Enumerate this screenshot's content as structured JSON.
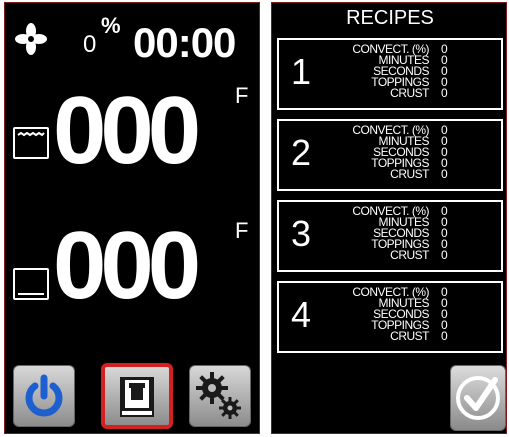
{
  "status": {
    "fan_icon": "fan-icon",
    "convection_percent": "0",
    "percent_sign": "%",
    "timer": "00:00"
  },
  "top_oven": {
    "icon": "top-oven-icon",
    "temperature": "000",
    "unit": "F"
  },
  "bottom_oven": {
    "icon": "bottom-oven-icon",
    "temperature": "000",
    "unit": "F"
  },
  "bottom_buttons": {
    "power": "power-icon",
    "recipes": "recipe-book-icon",
    "settings": "gears-icon",
    "selected_border_color": "#d42020"
  },
  "recipes": {
    "title": "RECIPES",
    "labels": [
      "CONVECT. (%)",
      "MINUTES",
      "SECONDS",
      "TOPPINGS",
      "CRUST"
    ],
    "items": [
      {
        "number": "1",
        "values": [
          "0",
          "0",
          "0",
          "0",
          "0"
        ]
      },
      {
        "number": "2",
        "values": [
          "0",
          "0",
          "0",
          "0",
          "0"
        ]
      },
      {
        "number": "3",
        "values": [
          "0",
          "0",
          "0",
          "0",
          "0"
        ]
      },
      {
        "number": "4",
        "values": [
          "0",
          "0",
          "0",
          "0",
          "0"
        ]
      }
    ],
    "confirm_icon": "checkmark-icon"
  }
}
